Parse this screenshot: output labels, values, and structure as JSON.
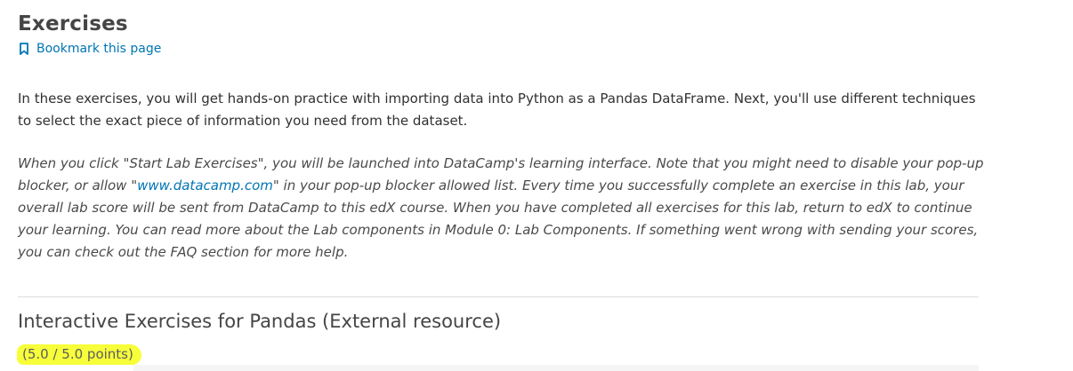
{
  "page": {
    "title": "Exercises",
    "bookmark_label": "Bookmark this page",
    "bookmark_icon": "bookmark-icon",
    "link_color": "#0075b4",
    "highlight_color": "#f7ff3a"
  },
  "intro": {
    "text": "In these exercises, you will get hands-on practice with importing data into Python as a Pandas DataFrame. Next, you'll use different techniques to select the exact piece of information you need from the dataset."
  },
  "note": {
    "text_before_link": "When you click \"Start Lab Exercises\", you will be launched into DataCamp's learning interface. Note that you might need to disable your pop-up blocker, or allow \"",
    "link_text": "www.datacamp.com",
    "text_after_link": "\" in your pop-up blocker allowed list. Every time you successfully complete an exercise in this lab, your overall lab score will be sent from DataCamp to this edX course. When you have completed all exercises for this lab, return to edX to continue your learning. You can read more about the Lab components in Module 0: Lab Components. If something went wrong with sending your scores, you can check out the FAQ section for more help."
  },
  "resource": {
    "title": "Interactive Exercises for Pandas (External resource)",
    "score": "(5.0 / 5.0 points)"
  }
}
